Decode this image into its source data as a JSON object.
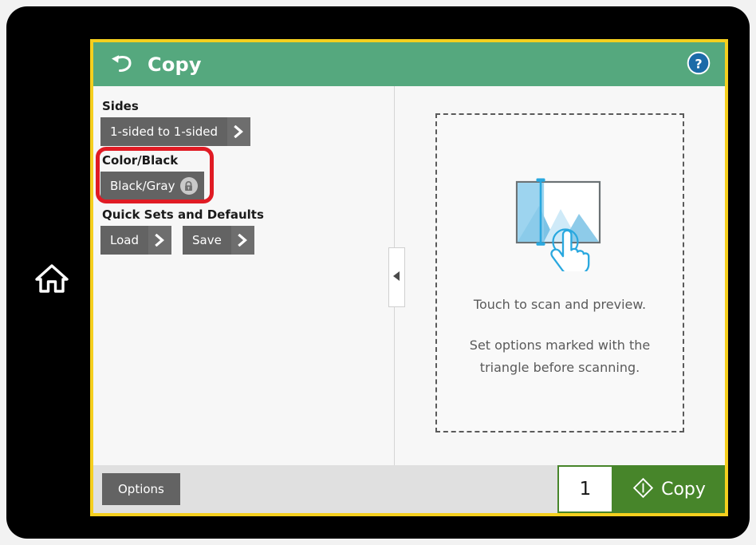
{
  "device": {
    "home_key_icon": "home-icon"
  },
  "header": {
    "back_icon": "back-arrow-icon",
    "title": "Copy",
    "help_icon": "help-question-icon",
    "bg_color": "#55a87e"
  },
  "settings": [
    {
      "label": "Sides",
      "control": "split",
      "value": "1-sided to 1-sided",
      "chevron_icon": "chevron-right-icon"
    },
    {
      "label": "Color/Black",
      "control": "lock",
      "value": "Black/Gray",
      "lock_icon": "lock-icon",
      "highlighted": true
    },
    {
      "label": "Quick Sets and Defaults",
      "control": "split-pair",
      "buttons": [
        {
          "value": "Load",
          "chevron_icon": "chevron-right-icon"
        },
        {
          "value": "Save",
          "chevron_icon": "chevron-right-icon"
        }
      ]
    }
  ],
  "collapse_handle": {
    "icon": "triangle-left-icon"
  },
  "preview": {
    "icon": "scan-preview-touch-icon",
    "line1": "Touch to scan and preview.",
    "line2": "Set options marked with the triangle before scanning."
  },
  "footer": {
    "options_label": "Options",
    "copy_count": "1",
    "copy_label": "Copy",
    "copy_icon": "copy-diamond-icon",
    "copy_button_color": "#47852a"
  },
  "annotation": {
    "color": "#e01b24",
    "target": "Color/Black"
  },
  "screen_border_color": "#f5cf1e"
}
